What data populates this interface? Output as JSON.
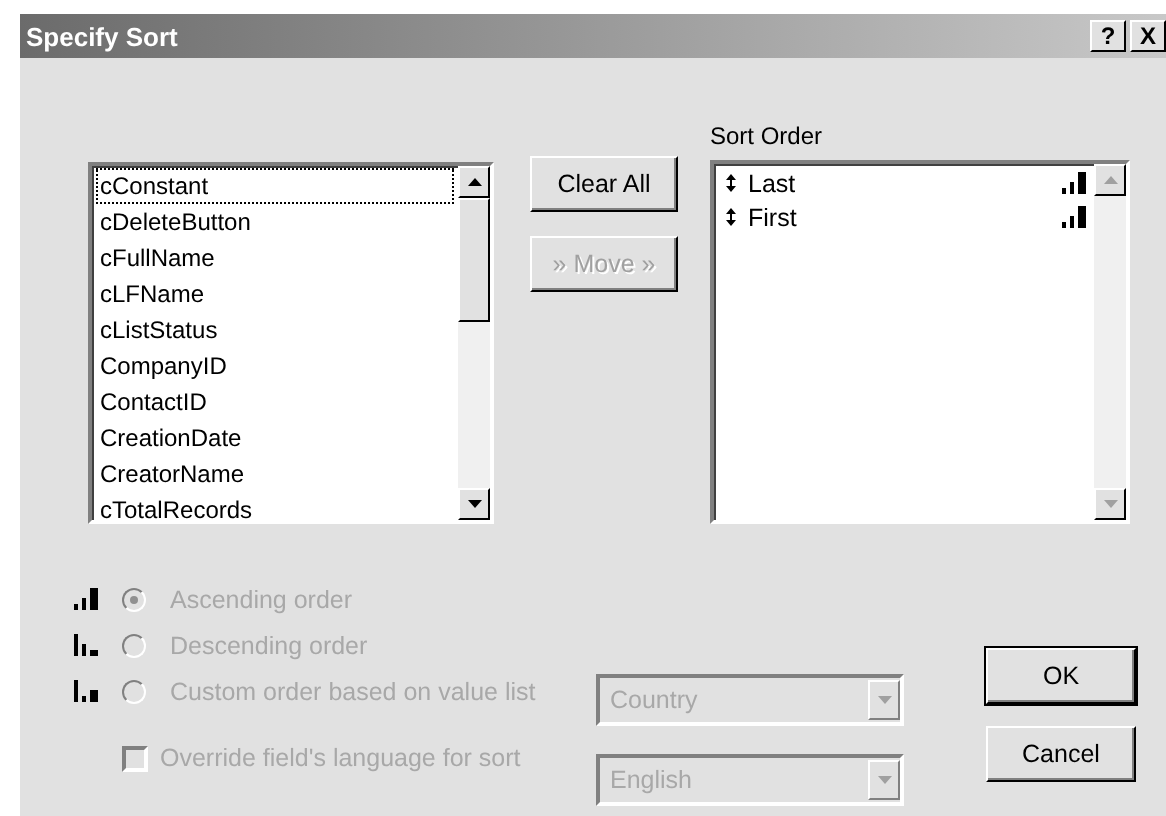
{
  "window": {
    "title": "Specify Sort",
    "help_button": "?",
    "close_button": "X"
  },
  "fields": [
    {
      "name": "cConstant",
      "focused": true
    },
    {
      "name": "cDeleteButton",
      "focused": false
    },
    {
      "name": "cFullName",
      "focused": false
    },
    {
      "name": "cLFName",
      "focused": false
    },
    {
      "name": "cListStatus",
      "focused": false
    },
    {
      "name": "CompanyID",
      "focused": false
    },
    {
      "name": "ContactID",
      "focused": false
    },
    {
      "name": "CreationDate",
      "focused": false
    },
    {
      "name": "CreatorName",
      "focused": false
    },
    {
      "name": "cTotalRecords",
      "focused": false
    }
  ],
  "clear_all_button": {
    "label": "Clear All",
    "disabled": false
  },
  "move_button": {
    "label": "» Move »",
    "disabled": true
  },
  "sort_order": {
    "label": "Sort Order",
    "items": [
      {
        "name": "Last",
        "kind": "ascending"
      },
      {
        "name": "First",
        "kind": "ascending"
      }
    ]
  },
  "order_options": [
    {
      "kind": "ascending",
      "label": "Ascending order",
      "selected": true,
      "disabled": true
    },
    {
      "kind": "descending",
      "label": "Descending order",
      "selected": false,
      "disabled": true
    },
    {
      "kind": "custom",
      "label": "Custom order based on value list",
      "selected": false,
      "disabled": true
    }
  ],
  "value_list_dropdown": {
    "value": "Country",
    "disabled": true
  },
  "override_language": {
    "label": "Override field's language for sort",
    "checked": false,
    "disabled": true
  },
  "language_dropdown": {
    "value": "English",
    "disabled": true
  },
  "ok_button": {
    "label": "OK",
    "default": true
  },
  "cancel_button": {
    "label": "Cancel",
    "default": false
  }
}
